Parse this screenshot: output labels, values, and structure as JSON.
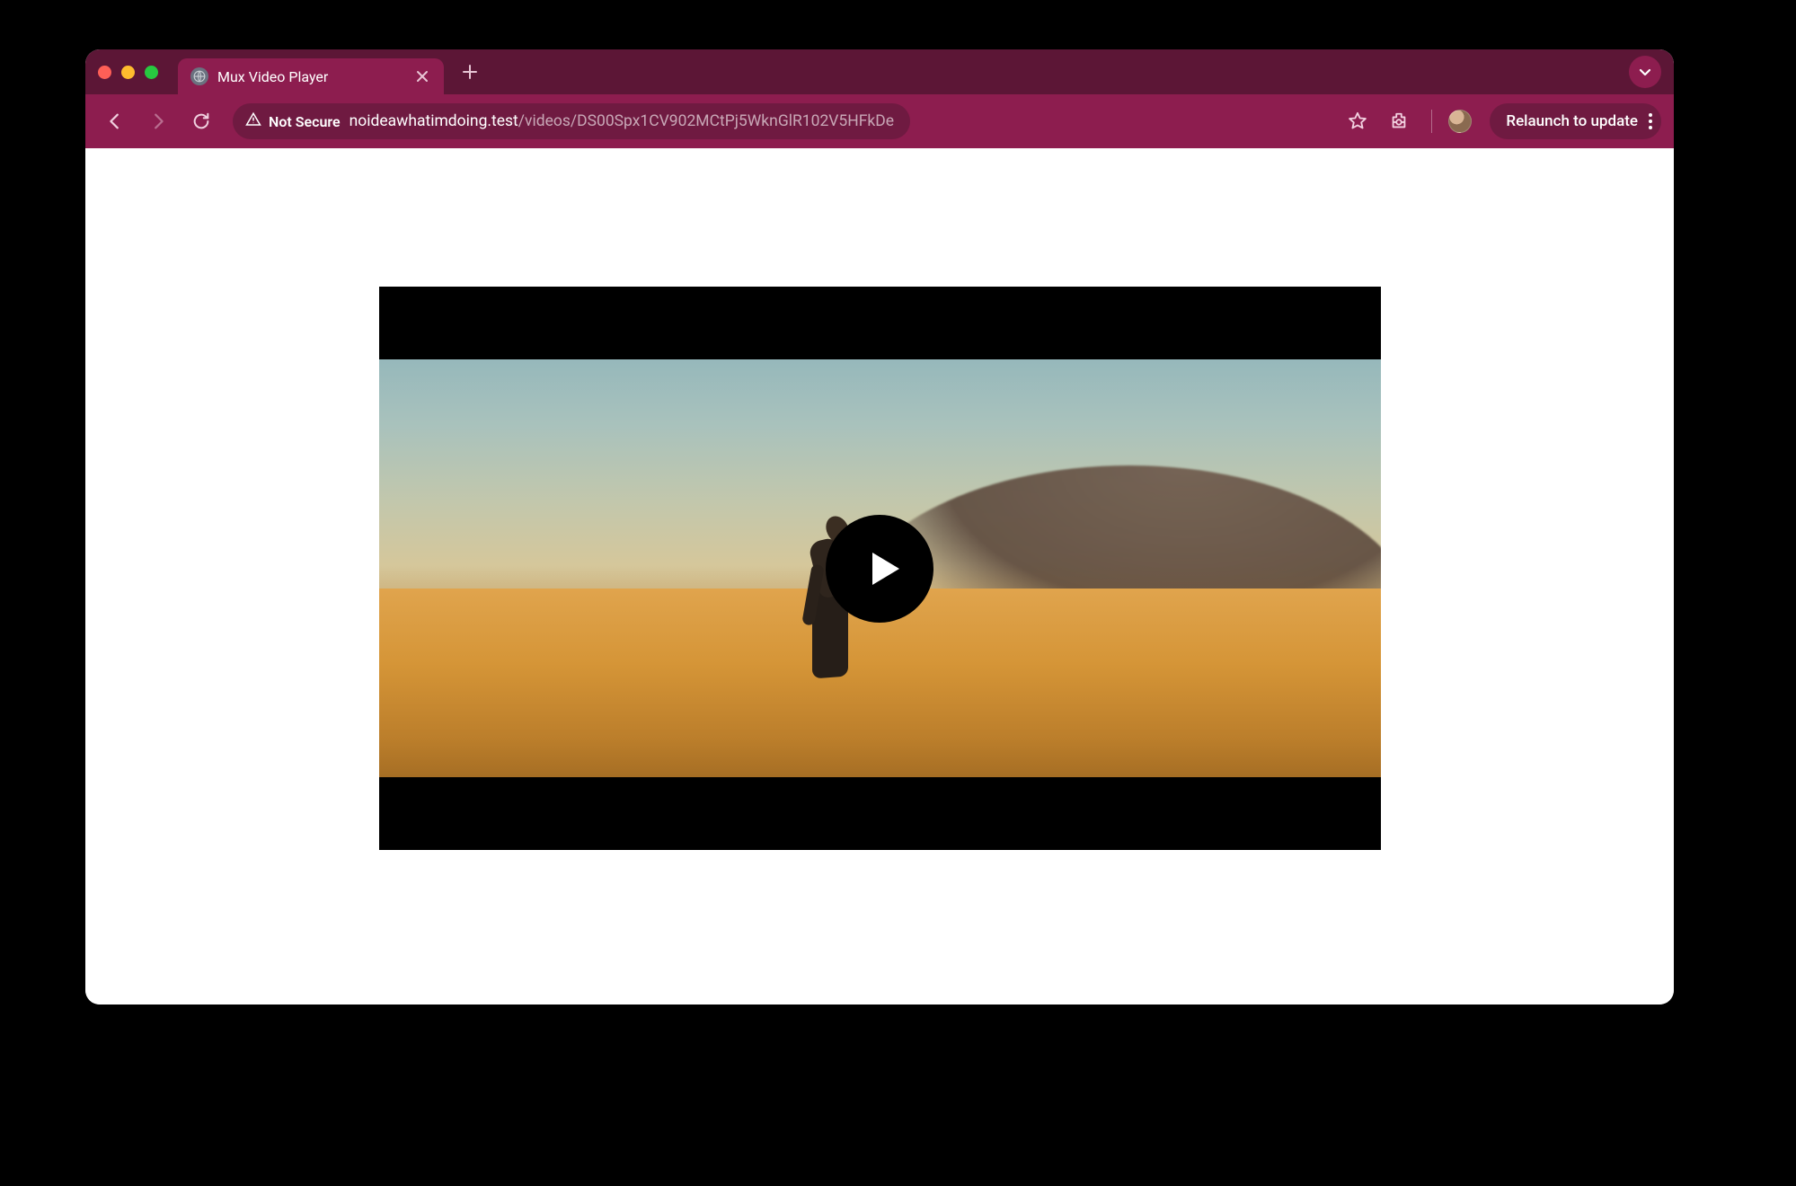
{
  "tab": {
    "title": "Mux Video Player"
  },
  "address": {
    "security_label": "Not Secure",
    "host": "noideawhatimdoing.test",
    "path": "/videos/DS00Spx1CV902MCtPj5WknGlR102V5HFkDe"
  },
  "toolbar": {
    "relaunch_label": "Relaunch to update"
  }
}
